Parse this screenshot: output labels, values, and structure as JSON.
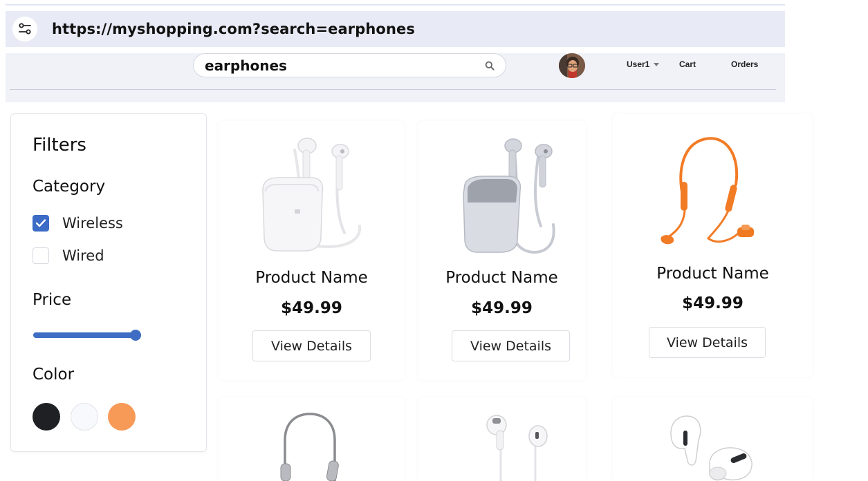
{
  "browser": {
    "url": "https://myshopping.com?search=earphones",
    "site_info_icon": "tune-icon"
  },
  "header": {
    "search_value": "earphones",
    "search_icon": "search-icon",
    "user_label": "User1",
    "cart_label": "Cart",
    "orders_label": "Orders"
  },
  "filters": {
    "title": "Filters",
    "category_label": "Category",
    "categories": [
      {
        "label": "Wireless",
        "checked": true
      },
      {
        "label": "Wired",
        "checked": false
      }
    ],
    "price_label": "Price",
    "price_slider_fraction": 0.95,
    "color_label": "Color",
    "colors": [
      "#1f2023",
      "#f8f9fc",
      "#f79a58"
    ]
  },
  "products": [
    {
      "name": "Product Name",
      "price": "$49.99",
      "button": "View Details"
    },
    {
      "name": "Product Name",
      "price": "$49.99",
      "button": "View Details"
    },
    {
      "name": "Product Name",
      "price": "$49.99",
      "button": "View Details"
    }
  ],
  "colors": {
    "accent": "#3c6cc6",
    "orange_product": "#f27b26"
  }
}
